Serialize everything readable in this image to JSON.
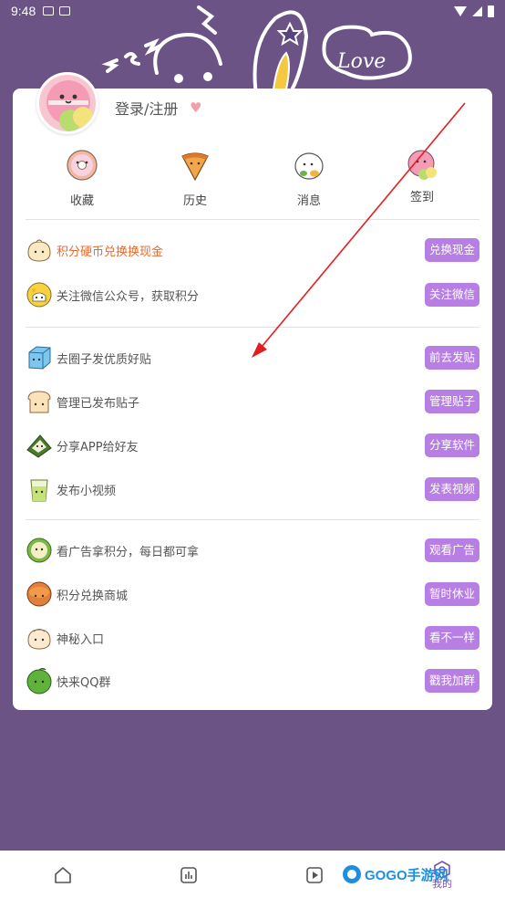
{
  "status_bar": {
    "time": "9:48"
  },
  "profile": {
    "login_label": "登录/注册"
  },
  "quick_actions": [
    {
      "label": "收藏",
      "icon": "donut-icon"
    },
    {
      "label": "历史",
      "icon": "pizza-icon"
    },
    {
      "label": "消息",
      "icon": "sushi-icon"
    },
    {
      "label": "签到",
      "icon": "macaron-icon"
    }
  ],
  "section1": [
    {
      "text": "积分硬币兑换换现金",
      "button": "兑换现金",
      "icon": "bun-icon",
      "accent": true
    },
    {
      "text": "关注微信公众号，获取积分",
      "button": "关注微信",
      "icon": "cheese-icon"
    }
  ],
  "section2": [
    {
      "text": "去圈子发优质好贴",
      "button": "前去发贴",
      "icon": "ice-cube-icon"
    },
    {
      "text": "管理已发布贴子",
      "button": "管理贴子",
      "icon": "toast-icon"
    },
    {
      "text": "分享APP给好友",
      "button": "分享软件",
      "icon": "rice-triangle-icon"
    },
    {
      "text": "发布小视频",
      "button": "发表视频",
      "icon": "drink-icon"
    }
  ],
  "section3": [
    {
      "text": "看广告拿积分，每日都可拿",
      "button": "观看广告",
      "icon": "roll-icon"
    },
    {
      "text": "积分兑换商城",
      "button": "暂时休业",
      "icon": "cookie-icon"
    },
    {
      "text": "神秘入口",
      "button": "看不一样",
      "icon": "dumpling-icon"
    },
    {
      "text": "快来QQ群",
      "button": "戳我加群",
      "icon": "lime-icon"
    }
  ],
  "bottom_nav": {
    "mine_label": "我的",
    "watermark": "GOGO手游网"
  },
  "colors": {
    "background": "#6b5386",
    "button": "#b77fe3",
    "accent_text": "#e8692e",
    "arrow": "#e02020"
  }
}
